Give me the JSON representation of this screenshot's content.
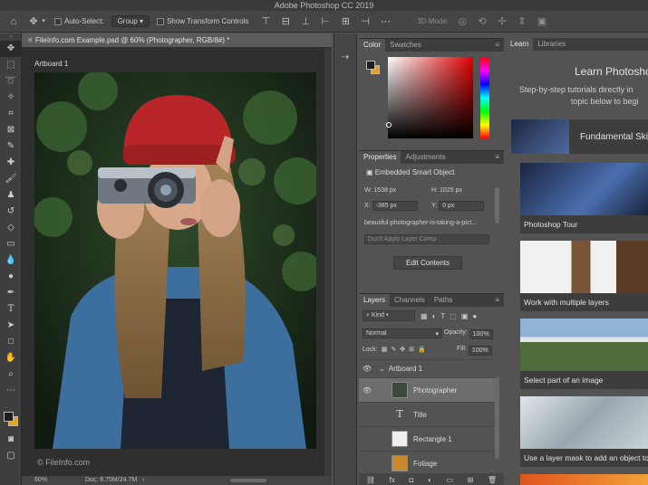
{
  "app_title": "Adobe Photoshop CC 2019",
  "options_bar": {
    "auto_select_label": "Auto-Select:",
    "auto_select_value": "Group",
    "show_transform_label": "Show Transform Controls",
    "mode_3d_label": "3D Mode:"
  },
  "document": {
    "tab_title": "FileInfo.com Example.psd @ 60% (Photographer, RGB/8#) *",
    "artboard_label": "Artboard 1",
    "watermark": "© FileInfo.com",
    "zoom": "60%",
    "doc_size": "Doc: 6.75M/24.7M"
  },
  "color_panel": {
    "tabs": [
      "Color",
      "Swatches"
    ]
  },
  "properties_panel": {
    "tabs": [
      "Properties",
      "Adjustments"
    ],
    "object_type": "Embedded Smart Object",
    "w_label": "W:",
    "w_value": "1538 px",
    "h_label": "H:",
    "h_value": "1025 px",
    "x_label": "X:",
    "x_value": "-385 px",
    "y_label": "Y:",
    "y_value": "0 px",
    "file_name": "beautiful-photographer-is-taking-a-pict...",
    "layer_comp": "Don't Apply Layer Comp",
    "edit_button": "Edit Contents"
  },
  "layers_panel": {
    "tabs": [
      "Layers",
      "Channels",
      "Paths"
    ],
    "filter": "Kind",
    "blend_mode": "Normal",
    "opacity_label": "Opacity:",
    "opacity_value": "100%",
    "lock_label": "Lock:",
    "fill_label": "Fill:",
    "fill_value": "100%",
    "layers": [
      {
        "name": "Artboard 1",
        "type": "artboard"
      },
      {
        "name": "Photographer",
        "type": "smart"
      },
      {
        "name": "Title",
        "type": "text"
      },
      {
        "name": "Rectangle 1",
        "type": "shape"
      },
      {
        "name": "Foliage",
        "type": "image"
      }
    ]
  },
  "learn_panel": {
    "tabs": [
      "Learn",
      "Libraries"
    ],
    "heading": "Learn Photosho",
    "subtext_1": "Step-by-step tutorials directly in",
    "subtext_2": "topic below to begi",
    "section": "Fundamental Ski",
    "cards": [
      "Photoshop Tour",
      "Work with multiple layers",
      "Select part of an image",
      "Use a layer mask to add an object to"
    ]
  },
  "colors": {
    "accent_fg": "#1e1e1e",
    "accent_bg": "#e8a21e",
    "hat_red": "#b8262a",
    "jacket_blue": "#3d6f9e"
  }
}
